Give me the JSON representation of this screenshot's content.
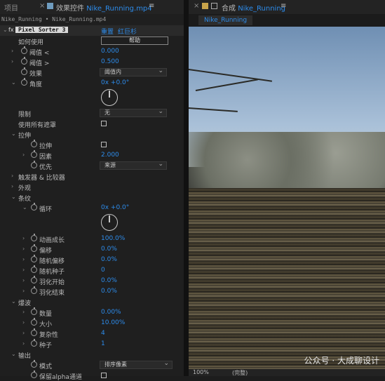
{
  "top": {
    "project_tab": "项目",
    "effects_tab_prefix": "效果控件",
    "effects_tab_file": "Nike_Running.mp4",
    "comp_tab_prefix": "合成",
    "comp_tab_name": "Nike_Running",
    "menu_icon": "≡",
    "close_icon": "×"
  },
  "effects": {
    "breadcrumb": "Nike_Running • Nike_Running.mp4",
    "plugin_name": "Pixel Sorter 3",
    "reset": "重置",
    "red_giant": "红巨杉",
    "how_to_use": "如何使用",
    "help_button": "帮助",
    "threshold_lt": "阈值 <",
    "threshold_lt_val": "0.000",
    "threshold_gt": "阈值 >",
    "threshold_gt_val": "0.500",
    "effect": "效果",
    "effect_val": "阈值内",
    "angle": "角度",
    "angle_val": "0x +0.0°",
    "limit": "限制",
    "limit_val": "无",
    "use_all_masks": "使用所有遮罩",
    "stretch_group": "拉伸",
    "stretch": "拉伸",
    "factor": "因素",
    "factor_val": "2.000",
    "priority": "优先",
    "priority_val": "来源",
    "trigger": "触发器 & 比较器",
    "appearance": "外观",
    "stripes": "条纹",
    "loop": "循环",
    "loop_val": "0x +0.0°",
    "anim_growth": "动画成长",
    "anim_growth_val": "100.0%",
    "offset": "偏移",
    "offset_val": "0.0%",
    "rand_offset": "随机偏移",
    "rand_offset_val": "0.0%",
    "rand_seed": "随机种子",
    "rand_seed_val": "0",
    "feather_start": "羽化开始",
    "feather_start_val": "0.0%",
    "feather_end": "羽化结束",
    "feather_end_val": "0.0%",
    "wave": "爆波",
    "count": "数量",
    "count_val": "0.00%",
    "size": "大小",
    "size_val": "10.00%",
    "complexity": "复杂性",
    "complexity_val": "4",
    "seed": "种子",
    "seed_val": "1",
    "output": "输出",
    "mode": "模式",
    "mode_val": "排序像素",
    "keep_alpha": "保留alpha通道"
  },
  "viewer": {
    "zoom": "100%",
    "resolution": "(完整)"
  },
  "watermark": "公众号 · 大成聊设计",
  "colors": {
    "accent": "#2d8ceb",
    "panel": "#1f1f1f"
  }
}
